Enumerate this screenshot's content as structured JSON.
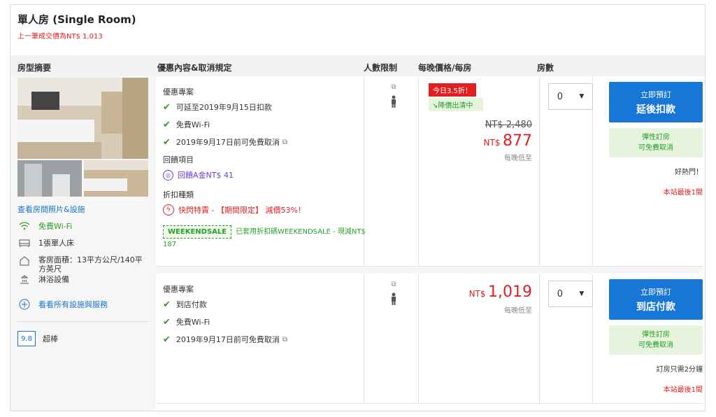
{
  "room": {
    "title": "單人房 (Single Room)",
    "last_price_note": "上一筆成交價為NT$ 1,013"
  },
  "columns": {
    "summary": "房型摘要",
    "offer": "優惠內容&取消規定",
    "occupancy": "人數限制",
    "price": "每晚價格/每房",
    "rooms": "房數"
  },
  "summary": {
    "photos_link": "查看房間照片&設施",
    "wifi": "免費Wi-Fi",
    "bed": "1張單人床",
    "area": "客房面積：13平方公尺/140平方英尺",
    "bath": "淋浴設備",
    "all_facilities": "看看所有設施與服務",
    "score": "9.8",
    "score_label": "超棒"
  },
  "offer1": {
    "heading": "優惠專案",
    "items": [
      "可延至2019年9月15日扣款",
      "免費Wi-Fi",
      "2019年9月17日前可免費取消"
    ],
    "reward_heading": "回饋項目",
    "reward": "回饋A金NT$ 41",
    "discount_heading": "折扣種類",
    "flash_sale": "快閃特賣 - 【期間限定】 減價53%！",
    "coupon_code": "WEEKENDSALE",
    "coupon_text": "已套用折扣碼WEEKENDSALE - 現減NT$ 187",
    "discount_badge": "今日3.5折！",
    "price_drop": "↘降價出清中",
    "old_price": "NT$ 2,480",
    "currency": "NT$",
    "price": "877",
    "per_night": "每晚低至",
    "qty": "0",
    "book_line1": "立即預訂",
    "book_line2": "延後扣款",
    "flex_line1": "彈性訂房",
    "flex_line2": "可免費取消",
    "hot": "好熱門！",
    "last_room": "本站最後1間"
  },
  "offer2": {
    "heading": "優惠專案",
    "items": [
      "到店付款",
      "免費Wi-Fi",
      "2019年9月17日前可免費取消"
    ],
    "currency": "NT$",
    "price": "1,019",
    "per_night": "每晚低至",
    "qty": "0",
    "book_line1": "立即預訂",
    "book_line2": "到店付款",
    "flex_line1": "彈性訂房",
    "flex_line2": "可免費取消",
    "note": "訂房只需2分鐘",
    "last_room": "本站最後1間"
  },
  "colors": {
    "accent": "#1777d6",
    "green": "#28a028",
    "red": "#e02020"
  }
}
